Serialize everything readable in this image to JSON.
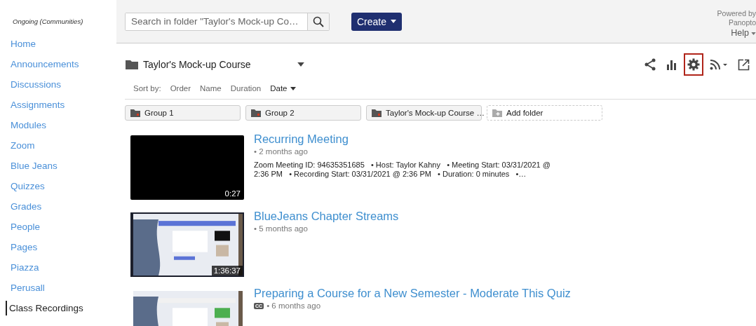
{
  "sidebar": {
    "heading": "Ongoing (Communities)",
    "items": [
      {
        "label": "Home",
        "selected": false
      },
      {
        "label": "Announcements",
        "selected": false
      },
      {
        "label": "Discussions",
        "selected": false
      },
      {
        "label": "Assignments",
        "selected": false
      },
      {
        "label": "Modules",
        "selected": false
      },
      {
        "label": "Zoom",
        "selected": false
      },
      {
        "label": "Blue Jeans",
        "selected": false
      },
      {
        "label": "Quizzes",
        "selected": false
      },
      {
        "label": "Grades",
        "selected": false
      },
      {
        "label": "People",
        "selected": false
      },
      {
        "label": "Pages",
        "selected": false
      },
      {
        "label": "Piazza",
        "selected": false
      },
      {
        "label": "Perusall",
        "selected": false
      },
      {
        "label": "Class Recordings",
        "selected": true
      }
    ]
  },
  "header": {
    "search": {
      "placeholder": "Search in folder \"Taylor's Mock-up Co…"
    },
    "create_button": "Create",
    "powered_by": [
      "Powered by",
      "Panopto"
    ],
    "help": "Help"
  },
  "folder": {
    "title": "Taylor's Mock-up Course",
    "toolbar": [
      {
        "kind": "share",
        "selected": false
      },
      {
        "kind": "stats",
        "selected": false
      },
      {
        "kind": "settings",
        "selected": true
      },
      {
        "kind": "rss",
        "selected": false
      },
      {
        "kind": "external",
        "selected": false
      }
    ]
  },
  "sort": {
    "label": "Sort by:",
    "options": [
      {
        "label": "Order",
        "selected": false
      },
      {
        "label": "Name",
        "selected": false
      },
      {
        "label": "Duration",
        "selected": false
      },
      {
        "label": "Date",
        "selected": true
      }
    ]
  },
  "subfolders": [
    {
      "label": "Group 1",
      "kind": "folder"
    },
    {
      "label": "Group 2",
      "kind": "folder"
    },
    {
      "label": "Taylor's Mock-up Course …",
      "kind": "folder"
    },
    {
      "label": "Add folder",
      "kind": "add"
    }
  ],
  "sessions": [
    {
      "title": "Recurring Meeting",
      "age": "• 2 months ago",
      "duration": "0:27",
      "description": "Zoom Meeting ID: 94635351685   • Host: Taylor Kahny   • Meeting Start: 03/31/2021 @ 2:36 PM   • Recording Start: 03/31/2021 @ 2:36 PM   • Duration: 0 minutes   •…"
    },
    {
      "title": "BlueJeans Chapter Streams",
      "age": "• 5 months ago",
      "kind": "picture",
      "duration": "1:36:37"
    },
    {
      "title": "Preparing a Course for a New Semester - Moderate This Quiz",
      "age": "• 6 months ago",
      "caption_badge": "CC",
      "kind": "picture"
    }
  ]
}
